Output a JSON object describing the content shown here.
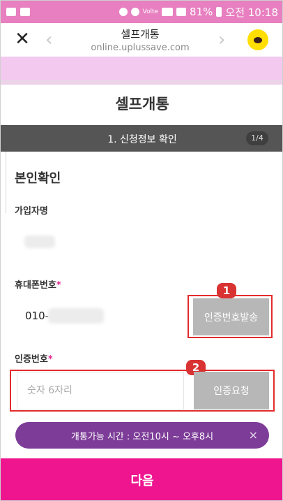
{
  "statusbar": {
    "battery": "81%",
    "time": "오전 10:18",
    "lte": "Volte"
  },
  "browser": {
    "title": "셀프개통",
    "url": "online.uplussave.com",
    "close_icon": "close-icon",
    "back_icon": "chevron-left-icon",
    "forward_icon": "chevron-right-icon",
    "share_icon": "kakao-chat-icon"
  },
  "page": {
    "title": "셀프개통",
    "step_label": "1. 신청정보 확인",
    "step_badge": "1/4",
    "section_title": "본인확인"
  },
  "form": {
    "name_label": "가입자명",
    "phone_label": "휴대폰번호",
    "required_mark": "*",
    "phone_prefix": "010-",
    "send_code_button": "인증번호발송",
    "code_label": "인증번호",
    "code_placeholder": "숫자 6자리",
    "verify_button": "인증요청"
  },
  "annotations": {
    "marker_1": "1",
    "marker_2": "2"
  },
  "notice": {
    "text": "개통가능 시간 : 오전10시 ~ 오후8시",
    "close": "×"
  },
  "footer": {
    "next_button": "다음"
  },
  "colors": {
    "statusbar": "#e87fc0",
    "banner": "#f3c9f0",
    "step_bar": "#555555",
    "notice": "#7d3c98",
    "next_button": "#ee158f",
    "annotation_red": "#e32b2b"
  }
}
